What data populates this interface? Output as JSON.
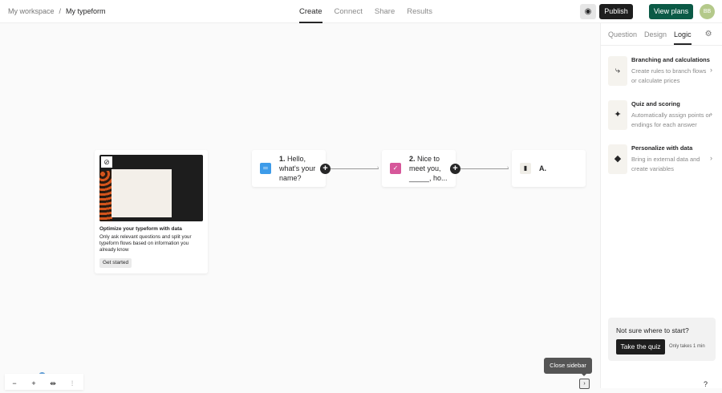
{
  "header": {
    "workspace": "My workspace",
    "separator": "/",
    "form": "My typeform",
    "tabs": [
      "Create",
      "Connect",
      "Share",
      "Results"
    ],
    "publish": "Publish",
    "view_plans": "View plans",
    "avatar": "BB"
  },
  "sidebar": {
    "tabs": [
      "Question",
      "Design",
      "Logic"
    ],
    "items": [
      {
        "title": "Branching and calculations",
        "desc": "Create rules to branch flows or calculate prices"
      },
      {
        "title": "Quiz and scoring",
        "desc": "Automatically assign points or endings for each answer"
      },
      {
        "title": "Personalize with data",
        "desc": "Bring in external data and create variables"
      }
    ],
    "quiz": {
      "question": "Not sure where to start?",
      "button": "Take the quiz",
      "note": "Only takes 1 min"
    },
    "help": "?"
  },
  "promo": {
    "title": "Optimize your typeform with data",
    "desc": "Only ask relevant questions and split your typeform flows based on information you already know",
    "button": "Get started"
  },
  "nodes": [
    {
      "num": "1.",
      "text": "Hello, what's your name?",
      "color": "#3d9be9"
    },
    {
      "num": "2.",
      "text": "Nice to meet you, _____, ho...",
      "color": "#d6579a"
    },
    {
      "num": "A.",
      "text": ""
    }
  ],
  "tooltip": "Close sidebar"
}
